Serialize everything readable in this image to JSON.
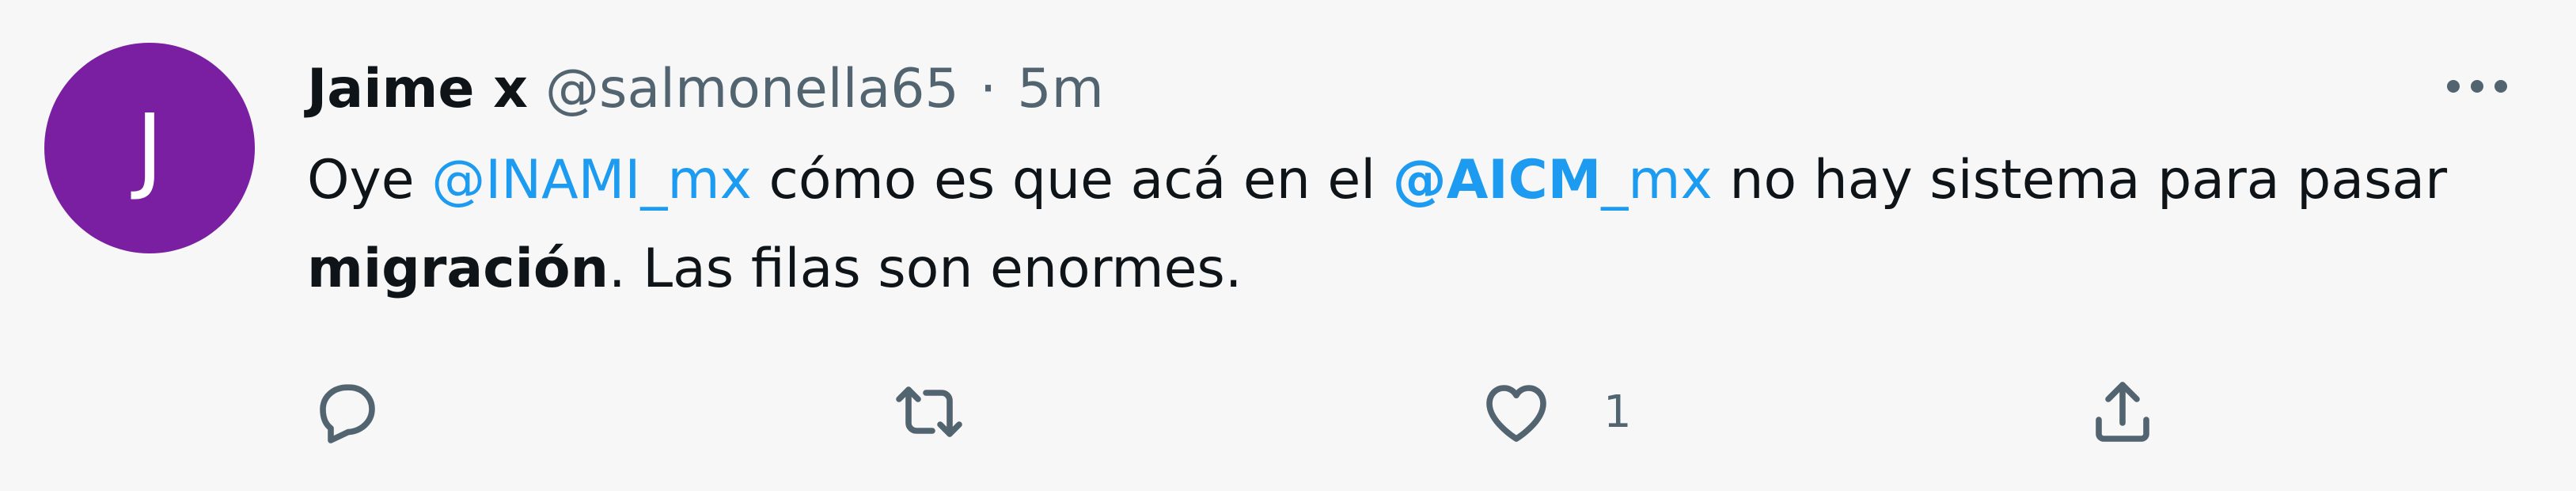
{
  "tweet": {
    "avatar_letter": "J",
    "avatar_color": "#7b1fa2",
    "display_name": "Jaime x",
    "handle": "@salmonella65",
    "separator": "·",
    "time": "5m",
    "text": {
      "part1": "Oye ",
      "mention1": "@INAMI_mx",
      "part2": " cómo es que acá en el ",
      "mention2_bold": "@AICM",
      "mention2_rest": "_mx",
      "part3": " no hay sistema para pasar ",
      "bold_word": "migración",
      "part4": ". Las filas son enormes."
    },
    "actions": {
      "reply_icon": "reply-icon",
      "retweet_icon": "retweet-icon",
      "like_icon": "heart-icon",
      "like_count": "1",
      "share_icon": "share-icon"
    },
    "colors": {
      "link": "#1d9bf0",
      "secondary_text": "#536471",
      "primary_text": "#0f1419",
      "background": "#f7f7f7"
    }
  }
}
